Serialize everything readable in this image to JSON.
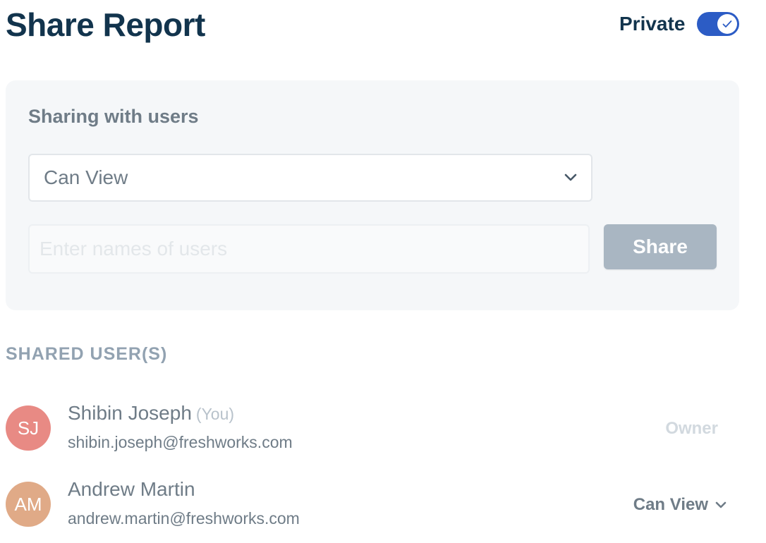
{
  "header": {
    "title": "Share Report",
    "private_label": "Private",
    "private_toggle_on": true,
    "toggle_color": "#2c5cc5"
  },
  "sharing": {
    "heading": "Sharing with users",
    "permission_value": "Can View",
    "users_input_placeholder": "Enter names of users",
    "users_input_value": "",
    "share_label": "Share"
  },
  "shared_users": {
    "heading": "SHARED USER(S)",
    "users": [
      {
        "initials": "SJ",
        "name": "Shibin Joseph",
        "you_tag": "(You)",
        "email": "shibin.joseph@freshworks.com",
        "role": "Owner",
        "avatar_color": "#e88a84"
      },
      {
        "initials": "AM",
        "name": "Andrew Martin",
        "email": "andrew.martin@freshworks.com",
        "permission": "Can View",
        "avatar_color": "#e0aa87"
      }
    ]
  },
  "icons": {
    "toggle_knob": "check-icon",
    "select_arrow": "chevron-down-icon"
  }
}
